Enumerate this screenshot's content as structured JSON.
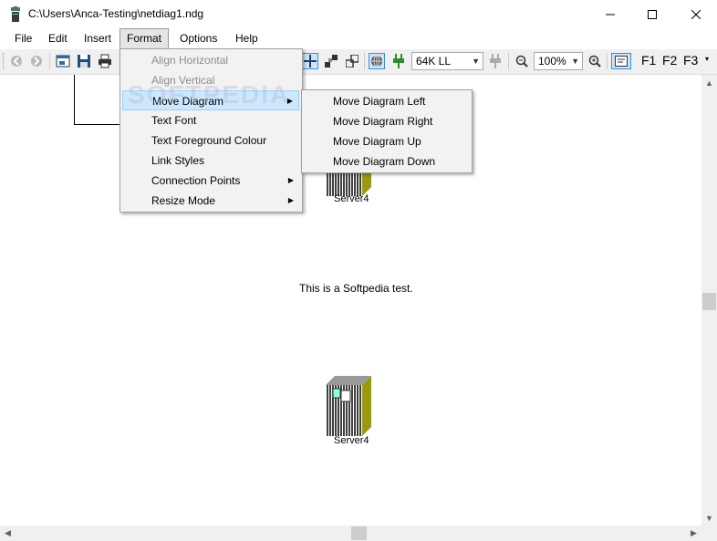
{
  "window": {
    "title": "C:\\Users\\Anca-Testing\\netdiag1.ndg",
    "minimize": "—",
    "maximize": "☐",
    "close": "✕"
  },
  "menubar": {
    "file": "File",
    "edit": "Edit",
    "insert": "Insert",
    "format": "Format",
    "options": "Options",
    "help": "Help"
  },
  "toolbar": {
    "speed_value": "64K LL",
    "zoom_value": "100%",
    "f1": "F1",
    "f2": "F2",
    "f3": "F3"
  },
  "format_menu": {
    "items": [
      {
        "label": "Align Horizontal",
        "enabled": false,
        "submenu": false
      },
      {
        "label": "Align Vertical",
        "enabled": false,
        "submenu": false
      },
      {
        "label": "Move Diagram",
        "enabled": true,
        "submenu": true
      },
      {
        "label": "Text Font",
        "enabled": true,
        "submenu": false
      },
      {
        "label": "Text Foreground Colour",
        "enabled": true,
        "submenu": false
      },
      {
        "label": "Link Styles",
        "enabled": true,
        "submenu": false
      },
      {
        "label": "Connection Points",
        "enabled": true,
        "submenu": true
      },
      {
        "label": "Resize Mode",
        "enabled": true,
        "submenu": true
      }
    ]
  },
  "move_diagram_submenu": {
    "items": [
      {
        "label": "Move Diagram Left"
      },
      {
        "label": "Move Diagram Right"
      },
      {
        "label": "Move Diagram Up"
      },
      {
        "label": "Move Diagram Down"
      }
    ]
  },
  "canvas": {
    "server_top_label": "Server4",
    "test_text": "This is a Softpedia test.",
    "server_bottom_label": "Server4"
  },
  "watermark": "SOFTPEDIA"
}
